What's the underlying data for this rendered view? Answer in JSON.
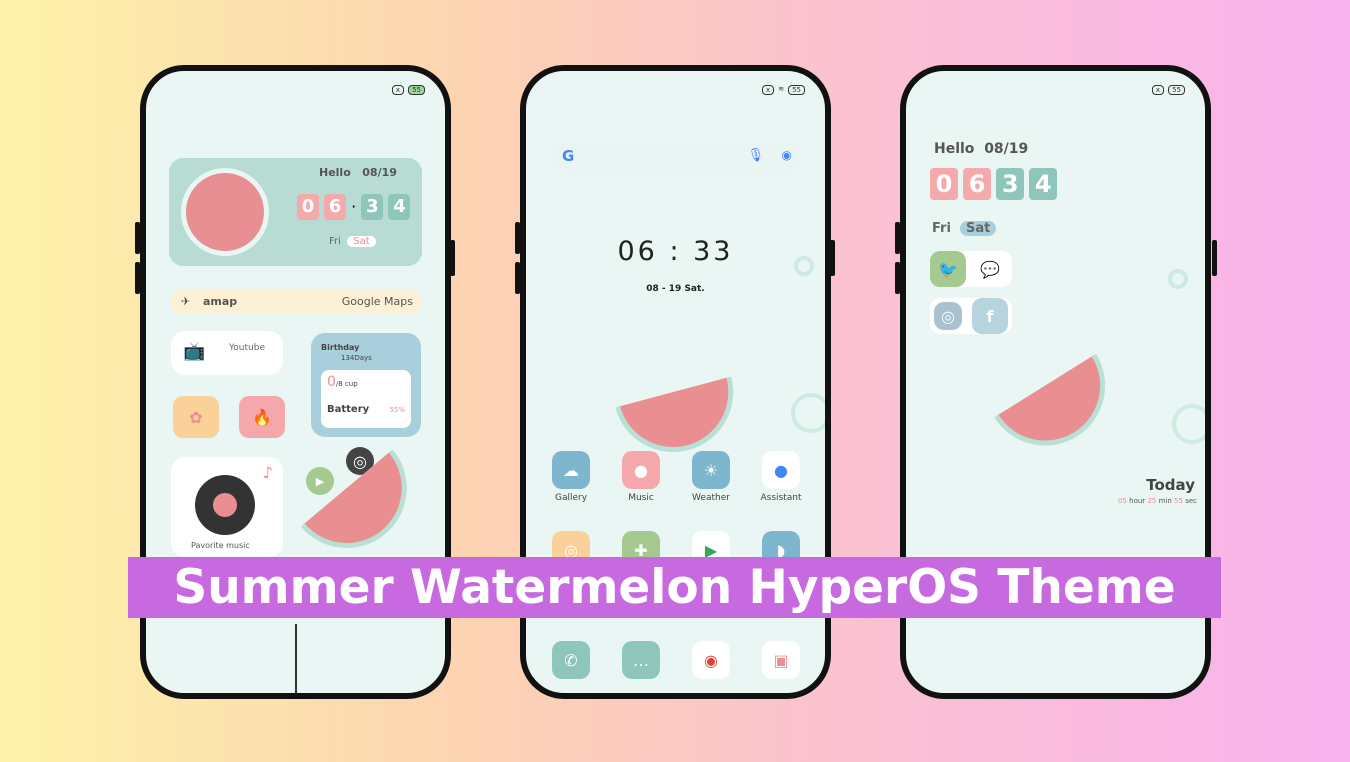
{
  "banner": {
    "title": "Summer Watermelon HyperOS Theme",
    "color": "#c76ae0"
  },
  "status": {
    "battery": "55"
  },
  "left_phone": {
    "clock": {
      "hello": "Hello",
      "date": "08/19",
      "digits": [
        "0",
        "6",
        "3",
        "4"
      ],
      "day1": "Fri",
      "day2": "Sat"
    },
    "maps": {
      "left": "amap",
      "right": "Google Maps"
    },
    "youtube": "Youtube",
    "birthday": {
      "title": "Birthday",
      "days": "134Days",
      "cups": "0",
      "cups_unit": "/8 cup",
      "battery_label": "Battery",
      "battery_value": "55%"
    },
    "music": "Pavorite music"
  },
  "middle_phone": {
    "time": "06 : 33",
    "date": "08 - 19  Sat.",
    "apps": [
      {
        "label": "Gallery",
        "icon": "gallery-icon",
        "color": "#7fb6cf"
      },
      {
        "label": "Music",
        "icon": "music-icon",
        "color": "#f5a8ab"
      },
      {
        "label": "Weather",
        "icon": "weather-icon",
        "color": "#7fb6cf"
      },
      {
        "label": "Assistant",
        "icon": "assistant-icon",
        "color": "#ffffff"
      }
    ],
    "dock": [
      {
        "icon": "phone-icon",
        "color": "#8fc6bb"
      },
      {
        "icon": "messages-icon",
        "color": "#8fc6bb"
      },
      {
        "icon": "chrome-icon",
        "color": "#ffffff"
      },
      {
        "icon": "camera-icon",
        "color": "#ffffff"
      }
    ]
  },
  "right_phone": {
    "hello": "Hello",
    "date": "08/19",
    "digits": [
      "0",
      "6",
      "3",
      "4"
    ],
    "day1": "Fri",
    "day2": "Sat",
    "today": "Today",
    "countdown": {
      "h": "05",
      "h_unit": "hour",
      "m": "25",
      "m_unit": "min",
      "s": "55",
      "s_unit": "sec"
    }
  }
}
